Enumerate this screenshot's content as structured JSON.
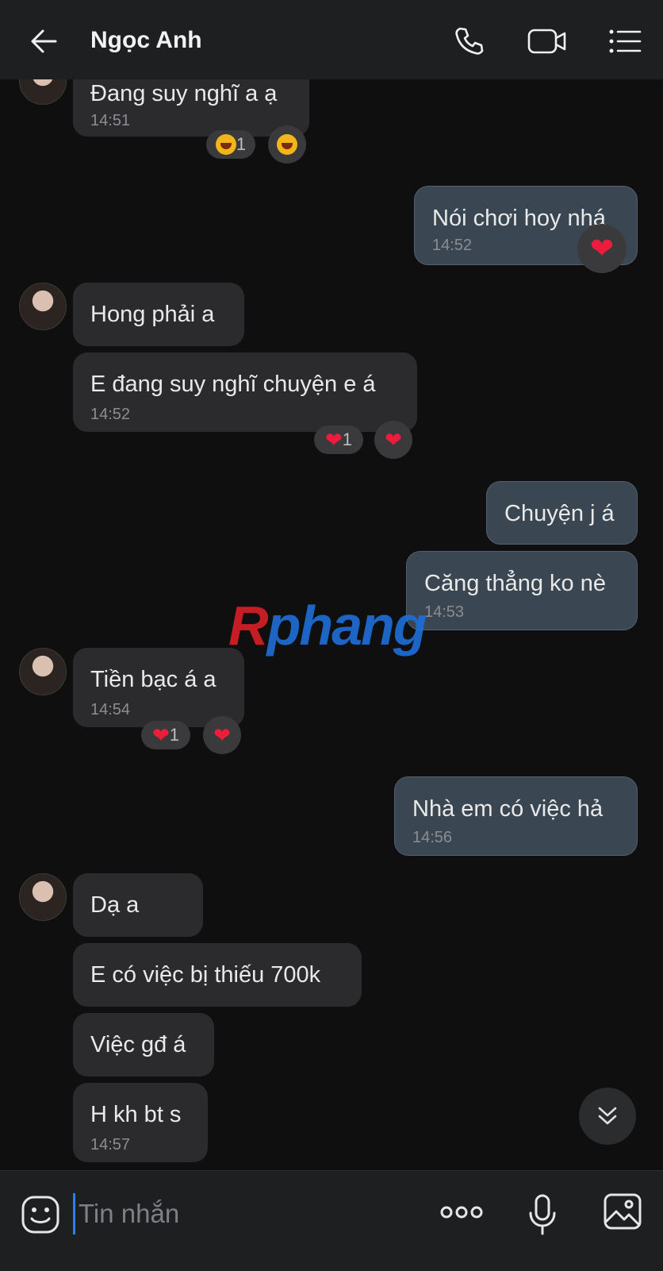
{
  "header": {
    "title": "Ngọc Anh",
    "icons": [
      "back-arrow-icon",
      "phone-icon",
      "video-call-icon",
      "menu-list-icon"
    ]
  },
  "messages": [
    {
      "side": "in",
      "text": "Đang suy nghĩ a ạ",
      "time": "14:51",
      "reaction": "laugh",
      "reaction_count": "1"
    },
    {
      "side": "out",
      "text": "Nói chơi hoy nhá",
      "time": "14:52",
      "reaction": "heart"
    },
    {
      "side": "in",
      "text": "Hong phải a"
    },
    {
      "side": "in",
      "text": "E đang suy nghĩ chuyện e á",
      "time": "14:52",
      "reaction": "heart",
      "reaction_count": "1"
    },
    {
      "side": "out",
      "text": "Chuyện j á"
    },
    {
      "side": "out",
      "text": "Căng thẳng ko nè",
      "time": "14:53"
    },
    {
      "side": "in",
      "text": "Tiền bạc á a",
      "time": "14:54",
      "reaction": "heart",
      "reaction_count": "1"
    },
    {
      "side": "out",
      "text": "Nhà em có việc hả",
      "time": "14:56"
    },
    {
      "side": "in",
      "text": "Dạ a"
    },
    {
      "side": "in",
      "text": "E có việc bị thiếu 700k"
    },
    {
      "side": "in",
      "text": "Việc gđ á"
    },
    {
      "side": "in",
      "text": "H kh bt s",
      "time": "14:57"
    }
  ],
  "watermark": {
    "part1": "R",
    "part2": "phang"
  },
  "composer": {
    "placeholder": "Tin nhắn",
    "icons": [
      "emoji-icon",
      "more-dots-icon",
      "microphone-icon",
      "image-icon"
    ]
  },
  "colors": {
    "incoming": "#2b2b2d",
    "outgoing": "#3a4651",
    "heart": "#ee1c3c",
    "accent": "#2c7ef2"
  }
}
